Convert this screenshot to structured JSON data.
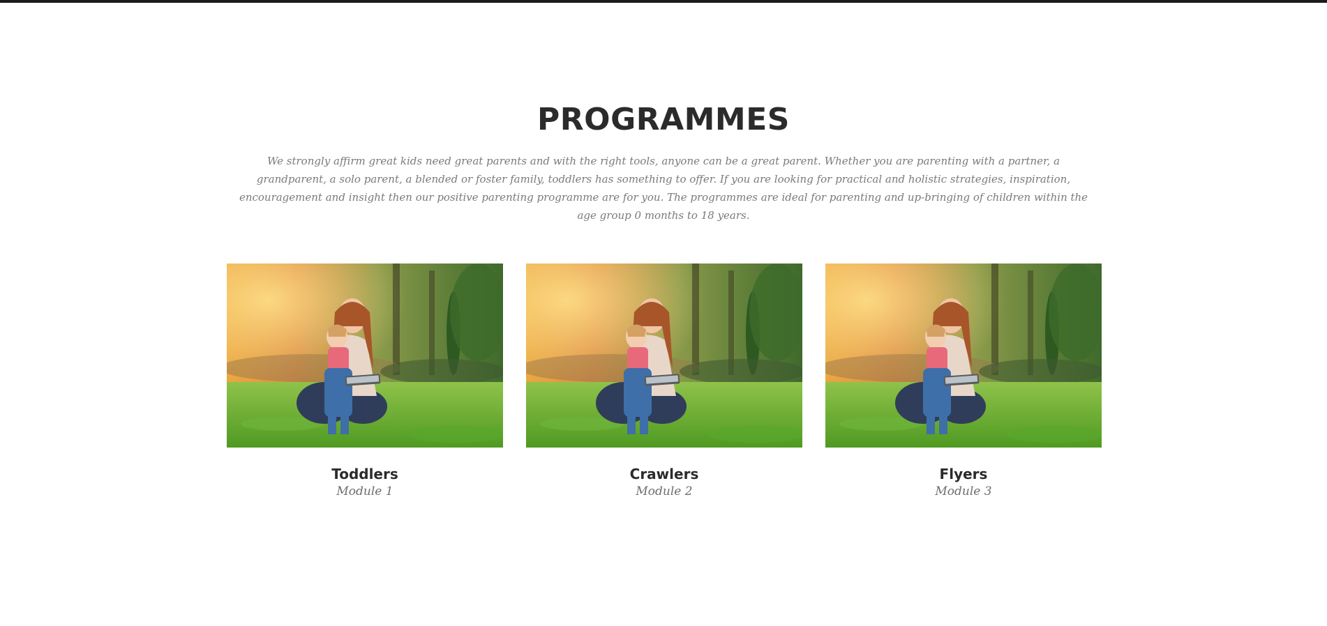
{
  "section": {
    "title": "PROGRAMMES",
    "intro": "We strongly affirm great kids need great parents and with the right tools, anyone can be a great parent. Whether you are parenting with a partner, a grandparent, a solo parent, a blended or foster family, toddlers has something to offer. If you are looking for practical and holistic strategies, inspiration, encouragement and insight then our positive parenting programme are for you. The programmes are ideal for parenting and up-bringing of children within the age group 0 months to 18 years."
  },
  "programmes": [
    {
      "title": "Toddlers",
      "module": "Module 1"
    },
    {
      "title": "Crawlers",
      "module": "Module 2"
    },
    {
      "title": "Flyers",
      "module": "Module 3"
    }
  ],
  "colors": {
    "heading": "#2b2b2b",
    "body_text": "#7a7a7a",
    "top_border": "#1b1b1b"
  }
}
